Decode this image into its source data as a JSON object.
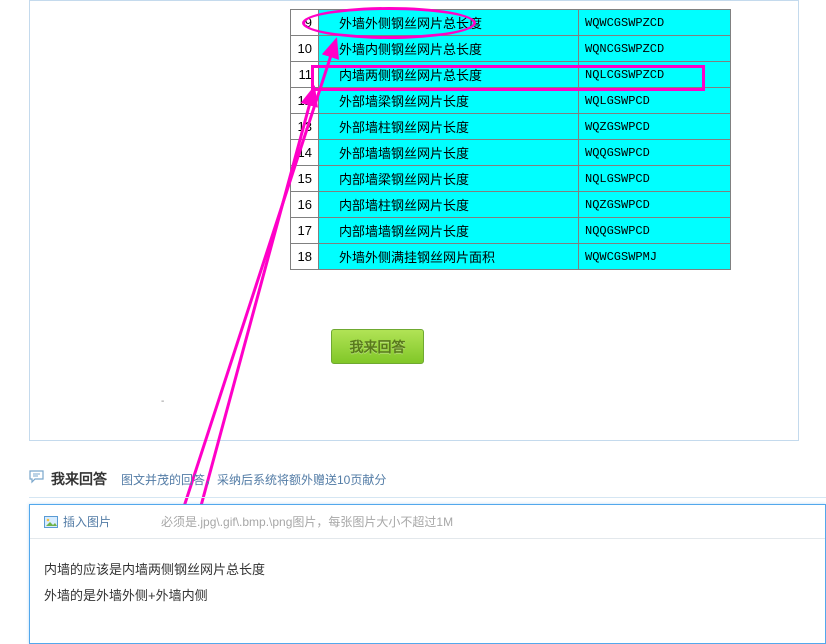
{
  "table": {
    "rows": [
      {
        "num": "9",
        "desc": "外墙外侧钢丝网片总长度",
        "code": "WQWCGSWPZCD"
      },
      {
        "num": "10",
        "desc": "外墙内侧钢丝网片总长度",
        "code": "WQNCGSWPZCD"
      },
      {
        "num": "11",
        "desc": "内墙两侧钢丝网片总长度",
        "code": "NQLCGSWPZCD"
      },
      {
        "num": "12",
        "desc": "外部墙梁钢丝网片长度",
        "code": "WQLGSWPCD"
      },
      {
        "num": "13",
        "desc": "外部墙柱钢丝网片长度",
        "code": "WQZGSWPCD"
      },
      {
        "num": "14",
        "desc": "外部墙墙钢丝网片长度",
        "code": "WQQGSWPCD"
      },
      {
        "num": "15",
        "desc": "内部墙梁钢丝网片长度",
        "code": "NQLGSWPCD"
      },
      {
        "num": "16",
        "desc": "内部墙柱钢丝网片长度",
        "code": "NQZGSWPCD"
      },
      {
        "num": "17",
        "desc": "内部墙墙钢丝网片长度",
        "code": "NQQGSWPCD"
      },
      {
        "num": "18",
        "desc": "外墙外侧满挂钢丝网片面积",
        "code": "WQWCGSWPMJ"
      }
    ]
  },
  "buttons": {
    "answer": "我来回答"
  },
  "section": {
    "title": "我来回答",
    "subtitle": "图文并茂的回答，采纳后系统将额外赠送10页献分"
  },
  "toolbar": {
    "insert_pic": "插入图片",
    "hint": "必须是.jpg\\.gif\\.bmp.\\png图片，每张图片大小不超过1M"
  },
  "content": {
    "line1": "内墙的应该是内墙两侧钢丝网片总长度",
    "line2": "外墙的是外墙外侧+外墙内侧"
  }
}
